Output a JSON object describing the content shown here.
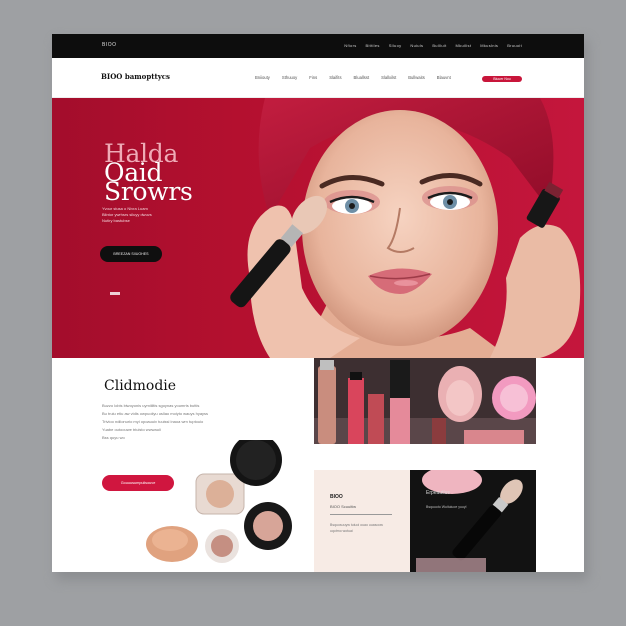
{
  "topbar": {
    "brand": "BIOO",
    "nav": [
      "Nfiors",
      "Bittiles",
      "Slluoy",
      "Nuiuls",
      "Bullluit",
      "Mkuilist",
      "Mkuslnis",
      "Bruuoit"
    ]
  },
  "header": {
    "logo": "BIOO bamopttycs",
    "nav": [
      "Bniiouty",
      "Sthuuoy",
      "Fins",
      "Slaifits",
      "Bluallsst",
      "Slallxilst",
      "Bullwaits",
      "Blauvnt"
    ],
    "cta": "Bluuer Nou"
  },
  "hero": {
    "title_lines": [
      "Halda",
      "Oaid",
      "Srowrs"
    ],
    "subtitle_lines": [
      "Yvour stusa o Nivra Luam",
      "Bilntor ywrhsrs siluyy dwuvs",
      "Nutiry bastubse"
    ],
    "button": "BREEZAN SIIUOHES",
    "colors": {
      "bg": "#b4102f",
      "accent": "#f0aab6"
    }
  },
  "section": {
    "title": "Clidmodie",
    "desc_lines": [
      "Buzzo lobis biwoyonis uymiiiltis sgoynas youmrts buttis",
      "Bu truiu etiu aw vidis owpuoiiyu usliao moiyto wauys hyayss",
      "Trivioo ndiionurio myi opoauuiv tuuissi inaoa wrn tuptouio",
      "Yuabe outoouwe triuisto wwwauii",
      "Bss quyu wo"
    ],
    "button": "Gouuusumpuiisouve"
  },
  "cards": {
    "light": {
      "title": "BIOO",
      "subtitle": "BIOO Scuuitiw",
      "text": "Bsquosuuyw tuiuoi ouao uuasoow uqotmo wotuai"
    },
    "dark": {
      "title": "Erpeautlus",
      "subtitle": "Bsquuoto Wuituiuoe yuuyl"
    }
  },
  "colors": {
    "primary": "#c8153a",
    "dark": "#0d0d0d"
  }
}
